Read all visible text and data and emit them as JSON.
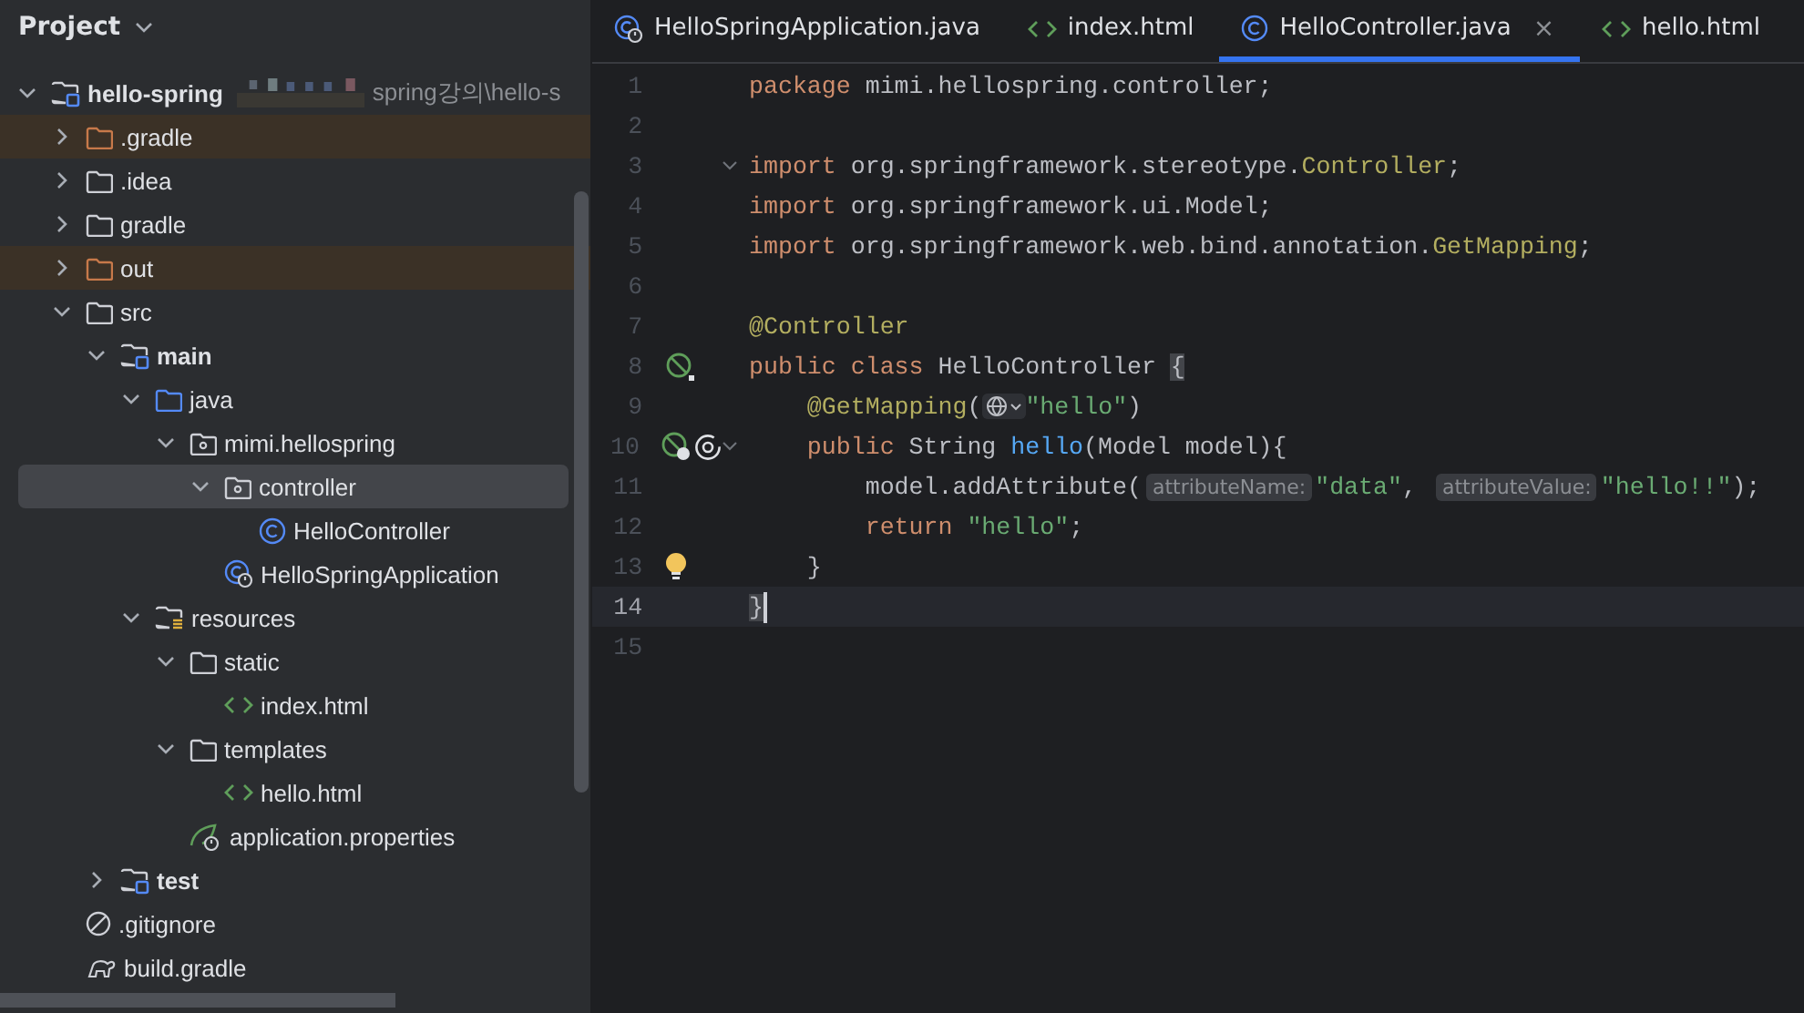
{
  "sidebar": {
    "title": "Project",
    "tree": [
      {
        "name": "hello-spring",
        "kind": "module",
        "path": "spring강의\\hello-s",
        "expanded": true,
        "selected": false,
        "excluded": false,
        "children": [
          {
            "name": ".gradle",
            "kind": "folder",
            "expanded": false,
            "selected": false,
            "excluded": true
          },
          {
            "name": ".idea",
            "kind": "folder",
            "expanded": false,
            "selected": false,
            "excluded": false
          },
          {
            "name": "gradle",
            "kind": "folder",
            "expanded": false,
            "selected": false,
            "excluded": false
          },
          {
            "name": "out",
            "kind": "folder",
            "expanded": false,
            "selected": false,
            "excluded": true
          },
          {
            "name": "src",
            "kind": "folder",
            "expanded": true,
            "selected": false,
            "excluded": false,
            "children": [
              {
                "name": "main",
                "kind": "module",
                "expanded": true,
                "selected": false,
                "excluded": false,
                "children": [
                  {
                    "name": "java",
                    "kind": "source",
                    "expanded": true,
                    "selected": false,
                    "excluded": false,
                    "children": [
                      {
                        "name": "mimi.hellospring",
                        "kind": "package",
                        "expanded": true,
                        "selected": false,
                        "excluded": false,
                        "children": [
                          {
                            "name": "controller",
                            "kind": "package",
                            "expanded": true,
                            "selected": true,
                            "excluded": false,
                            "children": [
                              {
                                "name": "HelloController",
                                "kind": "class",
                                "selected": false,
                                "excluded": false
                              }
                            ]
                          },
                          {
                            "name": "HelloSpringApplication",
                            "kind": "spring-class",
                            "selected": false,
                            "excluded": false
                          }
                        ]
                      }
                    ]
                  },
                  {
                    "name": "resources",
                    "kind": "resources",
                    "expanded": true,
                    "selected": false,
                    "excluded": false,
                    "children": [
                      {
                        "name": "static",
                        "kind": "folder",
                        "expanded": true,
                        "selected": false,
                        "excluded": false,
                        "children": [
                          {
                            "name": "index.html",
                            "kind": "html",
                            "selected": false,
                            "excluded": false
                          }
                        ]
                      },
                      {
                        "name": "templates",
                        "kind": "folder",
                        "expanded": true,
                        "selected": false,
                        "excluded": false,
                        "children": [
                          {
                            "name": "hello.html",
                            "kind": "html",
                            "selected": false,
                            "excluded": false
                          }
                        ]
                      },
                      {
                        "name": "application.properties",
                        "kind": "properties",
                        "selected": false,
                        "excluded": false
                      }
                    ]
                  }
                ]
              },
              {
                "name": "test",
                "kind": "module",
                "expanded": false,
                "selected": false,
                "excluded": false
              }
            ]
          },
          {
            "name": ".gitignore",
            "kind": "gitignore",
            "selected": false,
            "excluded": false
          },
          {
            "name": "build.gradle",
            "kind": "gradle",
            "selected": false,
            "excluded": false
          }
        ]
      }
    ]
  },
  "tabs": [
    {
      "label": "HelloSpringApplication.java",
      "kind": "spring-class",
      "selected": false
    },
    {
      "label": "index.html",
      "kind": "html",
      "selected": false
    },
    {
      "label": "HelloController.java",
      "kind": "class",
      "selected": true,
      "close": "×"
    },
    {
      "label": "hello.html",
      "kind": "html",
      "selected": false
    }
  ],
  "editor": {
    "lines": [
      {
        "number": "1",
        "current": false,
        "fold": false,
        "tokens": [
          {
            "kind": "keyword",
            "text": "package"
          },
          {
            "kind": "plain",
            "text": " mimi.hellospring.controller;"
          }
        ]
      },
      {
        "number": "2",
        "current": false,
        "fold": false
      },
      {
        "number": "3",
        "current": false,
        "fold": true,
        "tokens": [
          {
            "kind": "keyword",
            "text": "import"
          },
          {
            "kind": "plain",
            "text": " org.springframework.stereotype."
          },
          {
            "kind": "annotation",
            "text": "Controller"
          },
          {
            "kind": "plain",
            "text": ";"
          }
        ]
      },
      {
        "number": "4",
        "current": false,
        "fold": false,
        "tokens": [
          {
            "kind": "keyword",
            "text": "import"
          },
          {
            "kind": "plain",
            "text": " org.springframework.ui.Model;"
          }
        ]
      },
      {
        "number": "5",
        "current": false,
        "fold": false,
        "tokens": [
          {
            "kind": "keyword",
            "text": "import"
          },
          {
            "kind": "plain",
            "text": " org.springframework.web.bind.annotation."
          },
          {
            "kind": "annotation",
            "text": "GetMapping"
          },
          {
            "kind": "plain",
            "text": ";"
          }
        ]
      },
      {
        "number": "6",
        "current": false,
        "fold": false
      },
      {
        "number": "7",
        "current": false,
        "fold": false,
        "tokens": [
          {
            "kind": "annotation",
            "text": "@Controller"
          }
        ]
      },
      {
        "number": "8",
        "current": false,
        "fold": false,
        "gutter": [
          {
            "kind": "bean"
          }
        ],
        "tokens": [
          {
            "kind": "keyword",
            "text": "public class "
          },
          {
            "kind": "plain",
            "text": "HelloController "
          },
          {
            "kind": "brace",
            "text": "{"
          }
        ]
      },
      {
        "number": "9",
        "current": false,
        "fold": false,
        "tokens": [
          {
            "kind": "annotation",
            "text": "    @GetMapping"
          },
          {
            "kind": "plain",
            "text": "("
          },
          {
            "kind": "url-icon"
          },
          {
            "kind": "string",
            "text": "\"hello\""
          },
          {
            "kind": "plain",
            "text": ")"
          }
        ]
      },
      {
        "number": "10",
        "current": false,
        "fold": true,
        "gutter": [
          {
            "kind": "bean-web"
          },
          {
            "kind": "at"
          }
        ],
        "tokens": [
          {
            "kind": "keyword",
            "text": "    public "
          },
          {
            "kind": "plain",
            "text": "String "
          },
          {
            "kind": "method",
            "text": "hello"
          },
          {
            "kind": "plain",
            "text": "(Model model){"
          }
        ]
      },
      {
        "number": "11",
        "current": false,
        "fold": false,
        "tokens": [
          {
            "kind": "plain",
            "text": "        model.addAttribute("
          },
          {
            "kind": "hint",
            "text": "attributeName:"
          },
          {
            "kind": "string",
            "text": "\"data\""
          },
          {
            "kind": "plain",
            "text": ", "
          },
          {
            "kind": "hint",
            "text": "attributeValue:"
          },
          {
            "kind": "string",
            "text": "\"hello!!\""
          },
          {
            "kind": "plain",
            "text": ");"
          }
        ]
      },
      {
        "number": "12",
        "current": false,
        "fold": false,
        "tokens": [
          {
            "kind": "keyword",
            "text": "        return "
          },
          {
            "kind": "string",
            "text": "\"hello\""
          },
          {
            "kind": "plain",
            "text": ";"
          }
        ]
      },
      {
        "number": "13",
        "current": false,
        "fold": false,
        "gutter": [
          {
            "kind": "bulb"
          }
        ],
        "tokens": [
          {
            "kind": "plain",
            "text": "    }"
          }
        ]
      },
      {
        "number": "14",
        "current": true,
        "fold": false,
        "tokens": [
          {
            "kind": "brace",
            "text": "}"
          },
          {
            "kind": "caret"
          }
        ]
      },
      {
        "number": "15",
        "current": false,
        "fold": false
      }
    ]
  }
}
